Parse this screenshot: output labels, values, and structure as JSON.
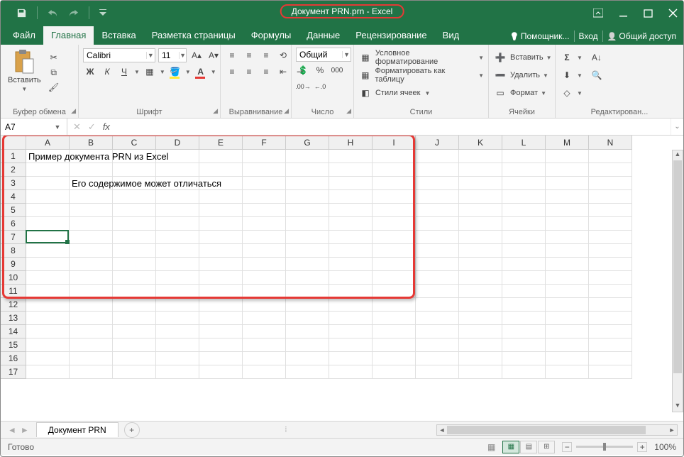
{
  "title": "Документ PRN.prn - Excel",
  "menu": {
    "file": "Файл",
    "home": "Главная",
    "insert": "Вставка",
    "layout": "Разметка страницы",
    "formulas": "Формулы",
    "data": "Данные",
    "review": "Рецензирование",
    "view": "Вид",
    "assistant": "Помощник...",
    "login": "Вход",
    "share": "Общий доступ"
  },
  "ribbon": {
    "paste": "Вставить",
    "clipboard_label": "Буфер обмена",
    "font_name": "Calibri",
    "font_size": "11",
    "font_label": "Шрифт",
    "bold": "Ж",
    "italic": "К",
    "underline": "Ч",
    "align_label": "Выравнивание",
    "number_format": "Общий",
    "number_label": "Число",
    "cond_format": "Условное форматирование",
    "format_table": "Форматировать как таблицу",
    "cell_styles": "Стили ячеек",
    "styles_label": "Стили",
    "insert_cells": "Вставить",
    "delete_cells": "Удалить",
    "format_cells": "Формат",
    "cells_label": "Ячейки",
    "editing_label": "Редактирован..."
  },
  "namebox": "A7",
  "columns": [
    "A",
    "B",
    "C",
    "D",
    "E",
    "F",
    "G",
    "H",
    "I",
    "J",
    "K",
    "L",
    "M",
    "N"
  ],
  "rows": [
    "1",
    "2",
    "3",
    "4",
    "5",
    "6",
    "7",
    "8",
    "9",
    "10",
    "11",
    "12",
    "13",
    "14",
    "15",
    "16",
    "17"
  ],
  "cell_A1": "Пример документа PRN из Excel",
  "cell_B3": "Его содержимое может отличаться",
  "sheet_name": "Документ PRN",
  "status": "Готово",
  "zoom": "100%"
}
